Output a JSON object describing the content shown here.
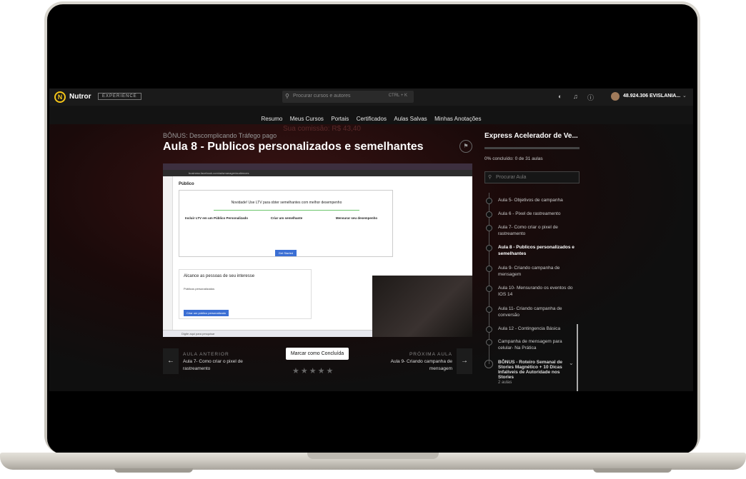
{
  "header": {
    "brand": "Nutror",
    "badge": "EXPERIENCE",
    "search_placeholder": "Procurar cursos e autores",
    "search_shortcut": "CTRL + K",
    "user_name": "48.924.306 EVISLANIA..."
  },
  "nav": {
    "items": [
      "Resumo",
      "Meus Cursos",
      "Portais",
      "Certificados",
      "Aulas Salvas",
      "Minhas Anotações"
    ]
  },
  "lesson": {
    "ghost_text": "Sua comissão: R$ 43,40",
    "breadcrumb": "BÔNUS: Descomplicando Tráfego pago",
    "title": "Aula 8 - Publicos personalizados e semelhantes"
  },
  "video": {
    "page_title": "Público",
    "card_heading": "Novidade! Use LTV para obter semelhantes com melhor desempenho",
    "step1": "Incluir LTV em um Público Personalizado",
    "step2": "Criar um semelhante",
    "step3": "Mensurar seu desempenho",
    "get_started": "Get Started",
    "reach_heading": "Alcance as pessoas de seu interesse",
    "reach_sub": "Públicos personalizados",
    "reach_button": "Criar um público personalizado",
    "taskbar_search": "Digite aqui para pesquisar"
  },
  "lesson_nav": {
    "prev_label": "AULA ANTERIOR",
    "prev_title": "Aula 7- Como criar o pixel de rastreamento",
    "next_label": "PRÓXIMA AULA",
    "next_title": "Aula 9- Criando campanha de mensagem",
    "complete_button": "Marcar como Concluída",
    "rating_stars": "★★★★★"
  },
  "sidebar": {
    "course_title": "Express Acelerador de Ve...",
    "progress_text": "0% concluído: 0 de 31 aulas",
    "progress": 0,
    "search_placeholder": "Procurar Aula",
    "lessons": [
      "Aula 5- Objetivos de campanha",
      "Aula 6 - Pixel de rastreamento",
      "Aula 7- Como criar o pixel de rastreamento",
      "Aula 8 - Publicos personalizados e semelhantes",
      "Aula 9- Criando campanha de mensagem",
      "Aula 10- Mensurando os eventos do IOS 14",
      "Aula 11- Criando campanha de conversão",
      "Aula 12 - Contingencia Básica",
      "Campanha de mensagem para celular- Na Prática"
    ],
    "active_index": 3,
    "bonus_title": "BÔNUS - Roteiro Semanal de Stories Magnético + 10 Dicas Infalíveis de Autoridade nos Stories",
    "bonus_count": "2 aulas"
  }
}
